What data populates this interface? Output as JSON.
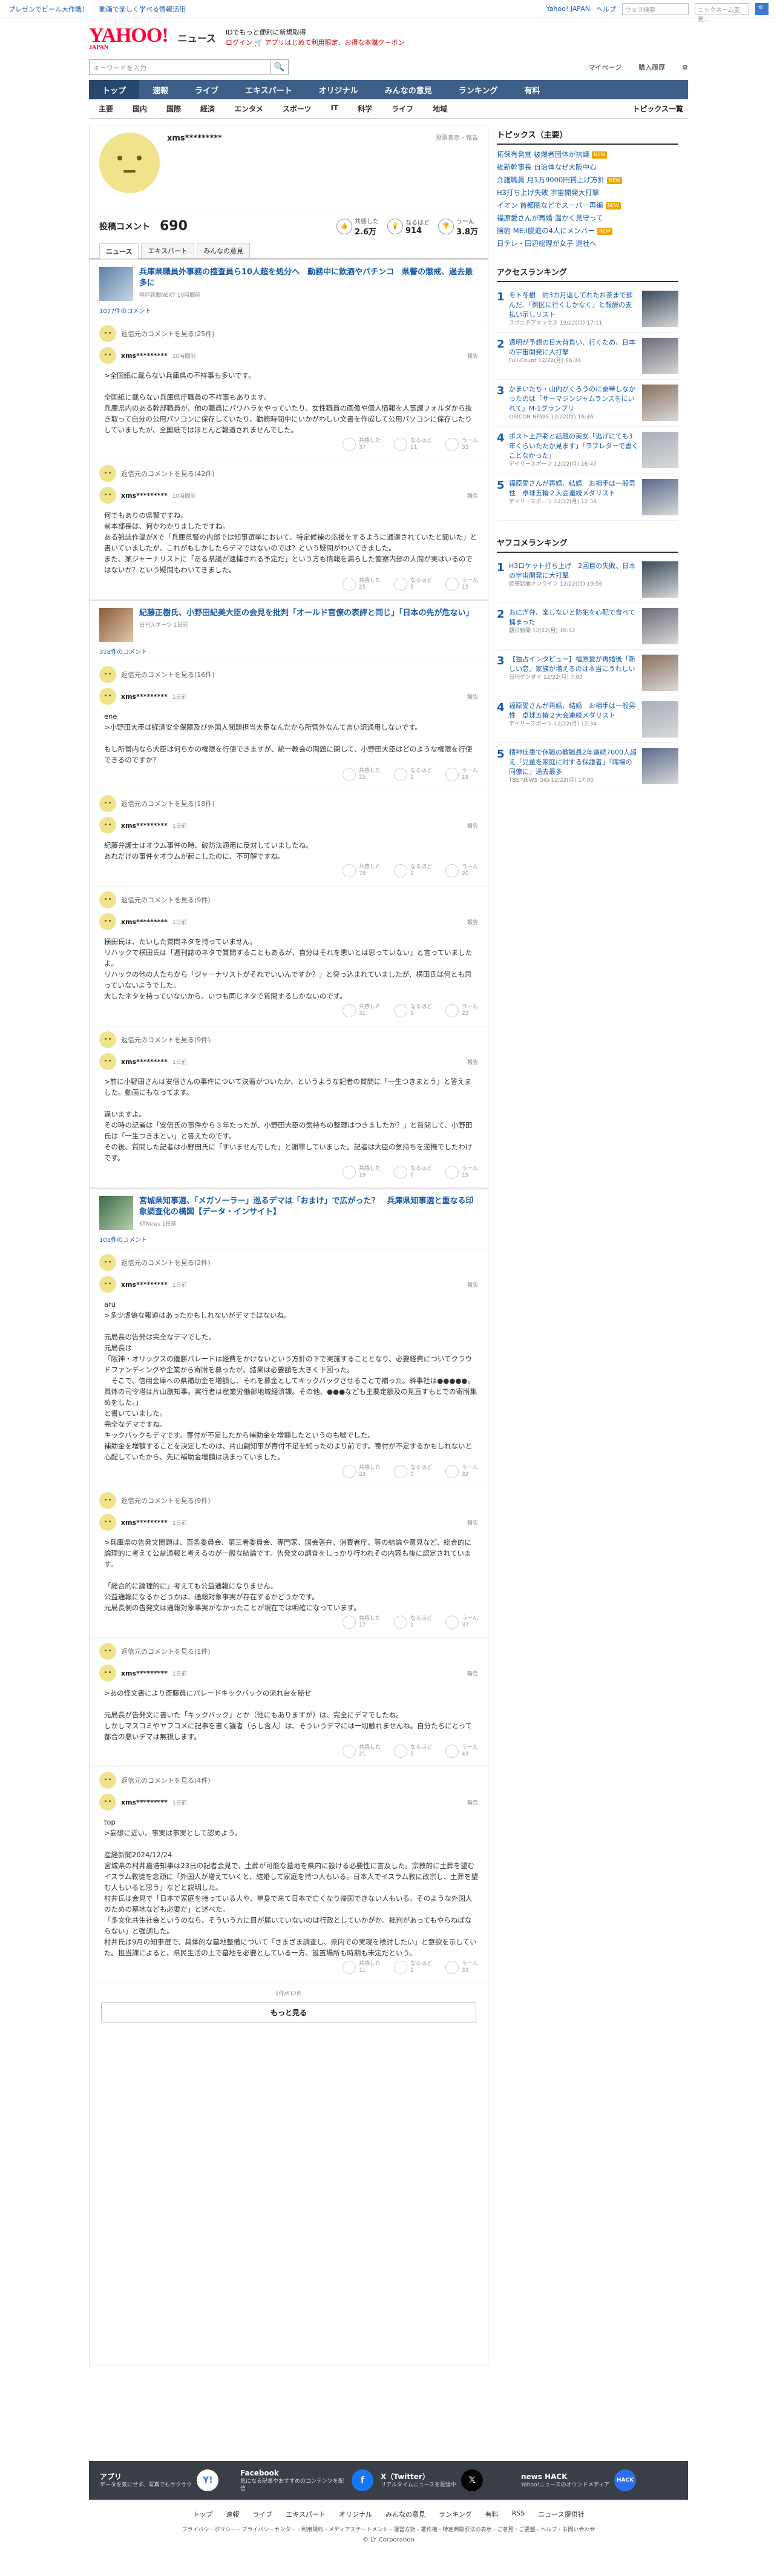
{
  "topbar": {
    "left": [
      "プレゼンでビール大作戦！",
      "動画で楽しく学べる情報活用"
    ],
    "yahoo_japan": "Yahoo! JAPAN",
    "help": "ヘルプ",
    "search_placeholder": "ウェブ検索",
    "nickname": "ニックネーム変更..."
  },
  "header": {
    "logo": "YAHOO!",
    "logo_sub": "JAPAN",
    "title": "ニュース",
    "promo1": "IDでもっと便利に新規取得",
    "promo2": "ログイン 🛒 アプリはじめて利用限定、お得な本購クーポン"
  },
  "search": {
    "placeholder": "キーワードを入力",
    "links": [
      "マイページ",
      "購入履歴",
      "⚙"
    ]
  },
  "mainnav": [
    "トップ",
    "速報",
    "ライブ",
    "エキスパート",
    "オリジナル",
    "みんなの意見",
    "ランキング",
    "有料"
  ],
  "subnav": [
    "主要",
    "国内",
    "国際",
    "経済",
    "エンタメ",
    "スポーツ",
    "IT",
    "科学",
    "ライフ",
    "地域"
  ],
  "subnav_right": "トピックス一覧",
  "profile": {
    "name": "xms*********",
    "report": "投票表示・報告",
    "label": "投稿コメント",
    "count": "690",
    "stats": [
      {
        "icon": "👍",
        "label": "共感した",
        "val": "2.6万"
      },
      {
        "icon": "💡",
        "label": "なるほど",
        "val": "914"
      },
      {
        "icon": "👎",
        "label": "うーん",
        "val": "3.8万"
      }
    ]
  },
  "tabs": [
    "ニュース",
    "エキスパート",
    "みんなの意見"
  ],
  "articles": [
    {
      "title": "兵庫県職員外事務の捜査員ら10人超を処分へ　勤務中に飲酒やパチンコ　県警の懲戒、過去最多に",
      "meta": "神戸新聞NEXT 10時間前",
      "cc": "1077件のコメント",
      "blocks": [
        {
          "parent": "返信元のコメントを見る(25件)",
          "name": "xms*********",
          "date": "10時間前",
          "report": "報告",
          "body": ">全国紙に載らない兵庫県の不祥事も多いです。\n\n全国紙に載らない兵庫県庁職員の不祥事もあります。\n兵庫県内のある幹部職員が、他の職員にパワハラをやっていたり、女性職員の画像や個人情報を人事課フォルダから抜き取って自分の公用パソコンに保存していたり、勤務時間中にいかがわしい文書を作成して公用パソコンに保存したりしていましたが、全国紙ではほとんど報道されませんでした。",
          "r": [
            "37",
            "11",
            "35"
          ]
        },
        {
          "parent": "返信元のコメントを見る(42件)",
          "name": "xms*********",
          "date": "10時間前",
          "report": "報告",
          "body": "何でもありの県警ですね。\n前本部長は、何かわかりましたですね。\nある雑誌作温がXで「兵庫県警の内部では知事選挙において、特定候補の応援をするように通達されていたと聞いた」と書いていましたが、これがもしかしたらデマではないのでは？という疑問がわいてきました。\nまた、某ジャーナリストに「ある県議が逮捕される予定だ」という方も情報を漏らした警察内部の人間が実はいるのではないか？という疑問もわいてきました。",
          "r": [
            "25",
            "5",
            "15"
          ]
        }
      ]
    },
    {
      "title": "紀藤正樹氏、小野田紀美大臣の会見を批判「オールド官僚の表評と同じ」「日本の先が危ない」",
      "meta": "日刊スポーツ 1日前",
      "cc": "318件のコメント",
      "blocks": [
        {
          "parent": "返信元のコメントを見る(16件)",
          "name": "xms*********",
          "date": "1日前",
          "report": "報告",
          "body": "ene\n>小野田大臣は経済安全保障及び外国人問題担当大臣なんだから所管外なんて言い訳通用しないです。\n\nもし所管内なら大臣は何らかの権限を行使できますが、統一教会の問題に関して、小野田大臣はどのような権限を行使できるのですか？",
          "r": [
            "25",
            "1",
            "18"
          ]
        },
        {
          "parent": "返信元のコメントを見る(18件)",
          "name": "xms*********",
          "date": "1日前",
          "report": "報告",
          "body": "紀藤弁護士はオウム事件の時、破防法適用に反対していましたね。\nあれだけの事件をオウムが起こしたのに、不可解ですね。",
          "r": [
            "78",
            "0",
            "20"
          ]
        },
        {
          "parent": "返信元のコメントを見る(9件)",
          "name": "xms*********",
          "date": "1日前",
          "report": "報告",
          "body": "横田氏は、たいした質問ネタを持っていません。\nリハックで横田氏は「週刊誌のネタで質問することもあるが、自分はそれを悪いとは思っていない」と言っていましたよ。\nリハックの他の人たちから「ジャーナリストがそれでいいんですか？」と突っ込まれていましたが、横田氏は何とも思っていないようでした。\n大したネタを持っていないから、いつも同じネタで質問するしかないのです。",
          "r": [
            "31",
            "5",
            "23"
          ]
        },
        {
          "parent": "返信元のコメントを見る(9件)",
          "name": "xms*********",
          "date": "1日前",
          "report": "報告",
          "body": ">前に小野田さんは安倍さんの事件について決着がついたか、というような記者の質問に「一生つきまとう」と答えました。動画にもなってます。\n\n違いますよ。\nその時の記者は「安倍氏の事件から３年たったが、小野田大臣の気持ちの整理はつきましたか？」と質問して、小野田氏は「一生つきまとい」と答えたのです。\nその後、質問した記者は小野田氏に「すいませんでした」と謝罪していました。記者は大臣の気持ちを逆撫でしたわけです。",
          "r": [
            "19",
            "0",
            "15"
          ]
        }
      ]
    },
    {
      "title": "宮城県知事選、「メガソーラー」巡るデマは「おまけ」で広がった？　兵庫県知事選と重なる印象調査化の構図【データ・インサイト】",
      "meta": "KTNews 1日前",
      "cc": "101件のコメント",
      "blocks": [
        {
          "parent": "返信元のコメントを見る(2件)",
          "name": "xms*********",
          "date": "1日前",
          "report": "報告",
          "body": "aru\n>多少虚偽な報道はあったかもしれないがデマではないね。\n\n元局長の告発は完全なデマでした。\n元局長は\n「阪神・オリックスの優勝パレードは経費をかけないという方針の下で実施することとなり、必要経費についてクラウドファンディングや企業から寄附を募ったが、結果は必要額を大きく下回った。\n　そこで、信用金庫への県補助金を増額し、それを募金としてキックバックさせることで補った。幹事社は●●●●●。具体の司令塔は片山副知事。実行者は産業労働部地域経済課。その他、●●●なども主要定額及の見直すもとでの寄附集めをした。」\nと書いていました。\n完全なデマですね。\nキックバックもデマです。寄付が不足したから補助金を増額したというのも嘘でした。\n補助金を増額することを決定したのは、片山副知事が寄付不足を知ったのより前です。寄付が不足するかもしれないと心配していたから、先に補助金増額は決まっていました。",
          "r": [
            "23",
            "0",
            "32"
          ]
        },
        {
          "parent": "返信元のコメントを見る(9件)",
          "name": "xms*********",
          "date": "1日前",
          "report": "報告",
          "body": ">兵庫県の告発文問題は、百条委員会、第三者委員会、専門家、国会答弁、消費者庁、等の結論や意見など、総合的に論理的に考えて公益通報と考えるのが一般な結論です。告発文の調査をしっかり行われその内容も後に認定されています。\n\n「総合的に論理的に」考えても公益通報になりません。\n公益通報になるかどうかは、通報対象事実が存在するかどうかです。\n元局長側の告発文は通報対象事実がなかったことが現在では明確になっています。",
          "r": [
            "17",
            "1",
            "37"
          ]
        },
        {
          "parent": "返信元のコメントを見る(1件)",
          "name": "xms*********",
          "date": "1日前",
          "report": "報告",
          "body": ">あの怪文書により斎藤員にパレードキックバックの流れ台を秘せ\n\n元局長が告発文に書いた「キックバック」とか（他にもありますが）は、完全にデマでしたね。\nしかしマスコミやヤフコメに記事を書く議者（らし含人）は、そういうデマには一切触れませんね。自分たちにとって都合の悪いデマは無視します。",
          "r": [
            "21",
            "0",
            "43"
          ]
        },
        {
          "parent": "返信元のコメントを見る(4件)",
          "name": "xms*********",
          "date": "1日前",
          "report": "報告",
          "body": "top\n>妄想に近い、事実は事実として認めよう。\n\n産経新聞2024/12/24\n宮城県の村井嘉浩知事は23日の記者会見で、土葬が可能な墓地を県内に設ける必要性に言及した。宗教的に土葬を望むイスラム教徒を念頭に「外国人が増えていくと、結婚して家庭を持つ人もいる。日本人でイスラム教に改宗し、土葬を望む人もいると思う」などと説明した。\n村井氏は会見で「日本で家庭を持っている人や、単身で来て日本で亡くなり帰国できない人もいる。そのような外国人のための墓地なども必要だ」と述べた。\n「多文化共生社会というのなら、そういう方に目が届いていないのは行政としていかがか。批判があってもやらねばならない」と強調した。\n村井氏は9月の知事選で、具体的な墓地整備について「さまざま調査し、県内での実現を検討したい」と意欲を示していた。担当課によると、県民生活の上で墓地を必要としている一方、設置場所も時期も未定だという。",
          "r": [
            "11",
            "1",
            "33"
          ]
        }
      ]
    }
  ],
  "more": {
    "page": "1件/612件",
    "button": "もっと見る"
  },
  "side": {
    "topics_title": "トピックス（主要）",
    "topics": [
      {
        "t": "拓保有発覚 被爆者団体が抗議",
        "b": "NEW"
      },
      {
        "t": "維新幹事長 自治体なぜ大阪中心",
        "b": ""
      },
      {
        "t": "介護職員 月1万9000円賃上げ方針",
        "b": "NEW"
      },
      {
        "t": "H3打ち上げ失敗 宇宙開発大打撃",
        "b": ""
      },
      {
        "t": "イオン 首都圏などでスーパー再編",
        "b": "NEW"
      },
      {
        "t": "福原愛さんが再婚 温かく見守って",
        "b": ""
      },
      {
        "t": "険豹 ME:I脱退の4人にメンバー",
        "b": "NEW"
      },
      {
        "t": "日テレ・田辺総理が女子 退社へ",
        "b": ""
      }
    ],
    "rank_title": "アクセスランキング",
    "ranks": [
      {
        "no": "1",
        "t": "モト冬樹　約3カ月返してれたお茶まで飲んだ、「例区に行くしかなく」と報酬の支払い示しリスト",
        "s": "スポニチアネックス 12/22(月) 17:11"
      },
      {
        "no": "2",
        "t": "透明が予想の日大背負い、行くため、日本の宇宙開発に大打撃",
        "s": "Full-Count 12/22(月) 16:34"
      },
      {
        "no": "3",
        "t": "かまいたち・山内がくろうのに豪華しなかったのは「サーマジンジャムランスをにいれて」M-1グランプリ",
        "s": "ORICON NEWS 12/22(月) 16:46"
      },
      {
        "no": "4",
        "t": "ポスト上戸彩と話題の美女「逃げにても3年くらいたたか見ます」「ラブレターで書くことなかった」",
        "s": "デイリースポーツ 12/22(月) 16:47"
      },
      {
        "no": "5",
        "t": "福原愛さんが再婚、結婚　お相手は一般男性　卓球五輪２大会連続メダリスト",
        "s": "デイリースポーツ 12/22(月) 12:34"
      }
    ],
    "ranks_title2": "ヤフコメランキング",
    "ranks2": [
      {
        "no": "1",
        "t": "H3ロケット打ち上げ　2回目の失敗、日本の宇宙開発に大打撃",
        "s": "読売新聞オンライン 12/22(月) 19:56"
      },
      {
        "no": "2",
        "t": "おにぎ弁、楽しないと防犯を心配で食べて捕まった",
        "s": "朝日新聞 12/22(月) 16:12"
      },
      {
        "no": "3",
        "t": "【独占インタビュー】福原愛が再婚後「新しい恋」家族が増えるのは本当にうれしい",
        "s": "日刊ゲンダイ 12/22(月) 7:00"
      },
      {
        "no": "4",
        "t": "福原愛さんが再婚、結婚　お相手は一般男性　卓球五輪２大会連続メダリスト",
        "s": "デイリースポーツ 12/22(月) 12:34"
      },
      {
        "no": "5",
        "t": "精神疾患で休職の教職員2年連続7000人超え「児童を家庭に対する保護者」「職場の同僚に」過去最多",
        "s": "TBS NEWS DIG 12/22(月) 17:00"
      }
    ]
  },
  "footer": {
    "items": [
      {
        "t": "アプリ",
        "d": "データを気にせず、写真でもサクサク"
      },
      {
        "t": "Facebook",
        "d": "気になる記事やおすすめのコンテンツを配信"
      },
      {
        "t": "X（Twitter）",
        "d": "リアルタイムニュースを配信中"
      },
      {
        "t": "news HACK",
        "d": "Yahoo!ニュースのオウンドメディア"
      }
    ],
    "nav": [
      "トップ",
      "速報",
      "ライブ",
      "エキスパート",
      "オリジナル",
      "みんなの意見",
      "ランキング",
      "有料",
      "RSS",
      "ニュース提供社"
    ],
    "links": "プライバシーポリシー - プライバシーセンター - 利用規約 - メディアステートメント - 運営方針 - 著作権・特定商取引法の表示 - ご意見・ご要望 - ヘルプ・お問い合わせ",
    "copyright": "© LY Corporation"
  }
}
